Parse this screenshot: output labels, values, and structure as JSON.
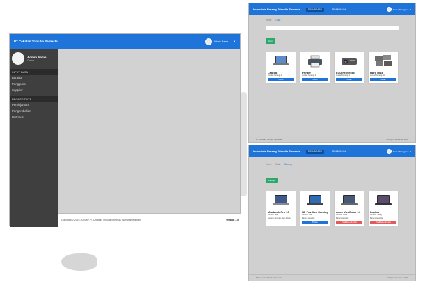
{
  "colors": {
    "primary": "#1e74d9",
    "sidebar": "#3f3f3f",
    "success": "#2ba86a",
    "danger": "#e45a5a"
  },
  "admin": {
    "brand": "PT Cekatan Trimulia Semesta",
    "user_name": "Admin Nama",
    "profile": {
      "name": "Admin Nama",
      "role": "Online"
    },
    "sections": [
      {
        "title": "INPUT DATA",
        "items": [
          "Barang",
          "Pengguna",
          "Supplier"
        ]
      },
      {
        "title": "PROSES DATA",
        "items": [
          "Peminjaman",
          "Pengembalian",
          "Distribusi"
        ]
      }
    ],
    "footer": "Copyright © 2019-2020 by PT Cekatan Trimulia Semesta. All rights reserved.",
    "version": "Version 1.0"
  },
  "catalog": {
    "brand": "Inventaris Barang Trimulia Semesta",
    "nav": [
      "DASHBOARD",
      "PEMINJAMAN"
    ],
    "user": "Nama Pengguna",
    "breadcrumb": [
      "Home",
      "Data"
    ],
    "add_label": "Cari",
    "cards": [
      {
        "title": "Laptop",
        "sub": "Jumlah barang: 4",
        "btn": "Detail",
        "icon": "laptop-icon"
      },
      {
        "title": "Printer",
        "sub": "Jumlah barang: 3",
        "btn": "Detail",
        "icon": "printer-icon"
      },
      {
        "title": "LCD Proyektor",
        "sub": "Jumlah barang: 2",
        "btn": "Detail",
        "icon": "projector-icon"
      },
      {
        "title": "Hard Disk",
        "sub": "Jumlah barang: 10",
        "btn": "Detail",
        "icon": "harddisk-icon"
      }
    ],
    "footer_left": "PT Cekatan Trimulia Semesta",
    "footer_right": "All Rights Reserved 2020"
  },
  "detail": {
    "brand": "Inventaris Barang Trimulia Semesta",
    "nav": [
      "DASHBOARD",
      "PEMINJAMAN"
    ],
    "user": "Nama Pengguna",
    "breadcrumb": [
      "Home",
      "Data",
      "Barang"
    ],
    "tag": "Laptop",
    "cards": [
      {
        "title": "Macbook Pro 13",
        "sub": "Kondisi: baik",
        "status": "Sedang dipinjam oleh Admin",
        "btn": "",
        "btn_type": "none"
      },
      {
        "title": "HP Pavilion Gaming",
        "sub": "Kondisi: baik",
        "status": "Barang tersedia",
        "btn": "Pinjam",
        "btn_type": "primary"
      },
      {
        "title": "Asus VivoBook 14",
        "sub": "Kondisi: rusak",
        "status": "Barang tersedia",
        "btn": "Tidak bisa dipinjam",
        "btn_type": "danger"
      },
      {
        "title": "Laptop",
        "sub": "Kondisi: hilang",
        "status": "Barang tersedia",
        "btn": "Tidak bisa dipinjam",
        "btn_type": "danger"
      }
    ],
    "footer_left": "PT Cekatan Trimulia Semesta",
    "footer_right": "All Rights Reserved 2020"
  }
}
